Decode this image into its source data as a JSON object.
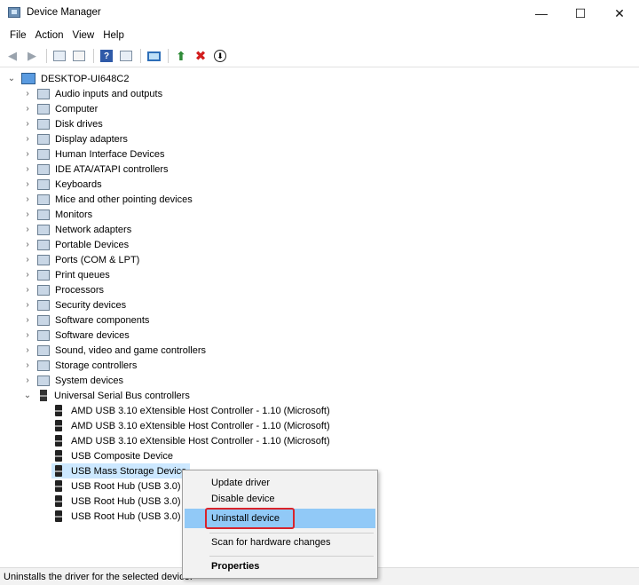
{
  "window": {
    "title": "Device Manager",
    "controls": {
      "minimize": "—",
      "maximize": "☐",
      "close": "✕"
    }
  },
  "menu": {
    "items": [
      "File",
      "Action",
      "View",
      "Help"
    ]
  },
  "toolbar": {
    "icons": [
      "back-arrow-icon",
      "forward-arrow-icon",
      "device-properties-icon",
      "refresh-icon",
      "help-icon",
      "show-hidden-icon",
      "scan-hardware-icon",
      "enable-device-icon",
      "uninstall-device-icon",
      "update-driver-icon"
    ]
  },
  "tree": {
    "root": "DESKTOP-UI648C2",
    "categories": [
      "Audio inputs and outputs",
      "Computer",
      "Disk drives",
      "Display adapters",
      "Human Interface Devices",
      "IDE ATA/ATAPI controllers",
      "Keyboards",
      "Mice and other pointing devices",
      "Monitors",
      "Network adapters",
      "Portable Devices",
      "Ports (COM & LPT)",
      "Print queues",
      "Processors",
      "Security devices",
      "Software components",
      "Software devices",
      "Sound, video and game controllers",
      "Storage controllers",
      "System devices",
      "Universal Serial Bus controllers"
    ],
    "usb_children": [
      "AMD USB 3.10 eXtensible Host Controller - 1.10 (Microsoft)",
      "AMD USB 3.10 eXtensible Host Controller - 1.10 (Microsoft)",
      "AMD USB 3.10 eXtensible Host Controller - 1.10 (Microsoft)",
      "USB Composite Device",
      "USB Mass Storage Device",
      "USB Root Hub (USB 3.0)",
      "USB Root Hub (USB 3.0)",
      "USB Root Hub (USB 3.0)"
    ],
    "selected": "USB Mass Storage Device"
  },
  "context_menu": {
    "items": [
      "Update driver",
      "Disable device",
      "Uninstall device",
      "Scan for hardware changes",
      "Properties"
    ],
    "highlighted": "Uninstall device"
  },
  "status": {
    "text": "Uninstalls the driver for the selected device."
  },
  "colors": {
    "selection": "#cce8ff",
    "highlight": "#91c9f7",
    "annotation": "#d9232b"
  }
}
